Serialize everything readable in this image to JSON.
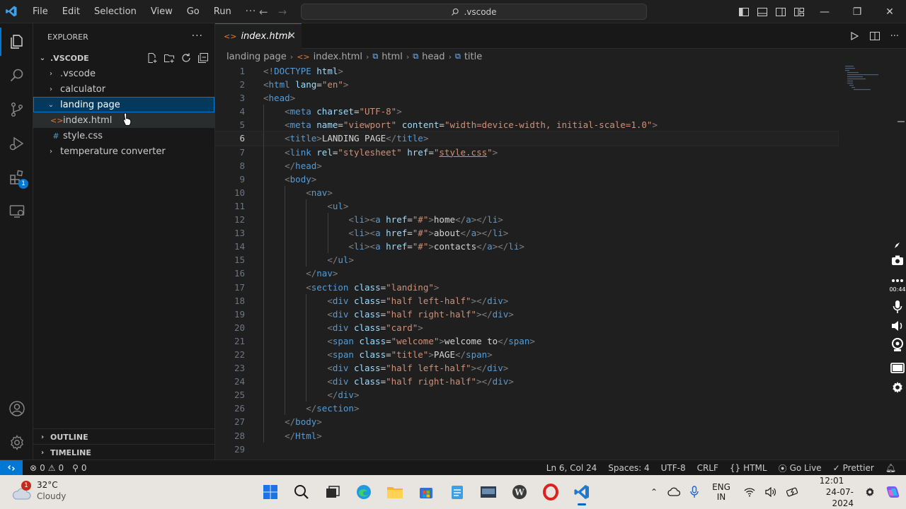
{
  "menu": [
    "File",
    "Edit",
    "Selection",
    "View",
    "Go",
    "Run",
    "···"
  ],
  "search": {
    "text": ".vscode"
  },
  "sidebar": {
    "title": "EXPLORER",
    "more": "···",
    "root": ".VSCODE",
    "items": [
      {
        "label": ".vscode",
        "type": "folder",
        "depth": 0,
        "expanded": false
      },
      {
        "label": "calculator",
        "type": "folder",
        "depth": 0,
        "expanded": false
      },
      {
        "label": "landing page",
        "type": "folder",
        "depth": 0,
        "expanded": true,
        "selected": true
      },
      {
        "label": "index.html",
        "type": "html",
        "depth": 1
      },
      {
        "label": "style.css",
        "type": "css",
        "depth": 1
      },
      {
        "label": "temperature converter",
        "type": "folder",
        "depth": 0,
        "expanded": false
      }
    ],
    "outline": "OUTLINE",
    "timeline": "TIMELINE"
  },
  "activity": {
    "extensions_badge": "1"
  },
  "tab": {
    "label": "index.html",
    "close": "✕"
  },
  "breadcrumb": [
    "landing page",
    "index.html",
    "html",
    "head",
    "title"
  ],
  "editor": {
    "current_line": 6,
    "lines": [
      "<!DOCTYPE html>",
      "<html lang=\"en\">",
      "<head>",
      "    <meta charset=\"UTF-8\">",
      "    <meta name=\"viewport\" content=\"width=device-width, initial-scale=1.0\">",
      "    <title>LANDING PAGE</title>",
      "    <link rel=\"stylesheet\" href=\"style.css\">",
      "    </head>",
      "    <body>",
      "        <nav>",
      "            <ul>",
      "                <li><a href=\"#\">home</a></li>",
      "                <li><a href=\"#\">about</a></li>",
      "                <li><a href=\"#\">contacts</a></li>",
      "            </ul>",
      "        </nav>",
      "        <section class=\"landing\">",
      "            <div class=\"half left-half\"></div>",
      "            <div class=\"half right-half\"></div>",
      "            <div class=\"card\">",
      "            <span class=\"welcome\">welcome to</span>",
      "            <span class=\"title\">PAGE</span>",
      "            <div class=\"half left-half\"></div>",
      "            <div class=\"half right-half\"></div>",
      "            </div>",
      "        </section>",
      "    </body>",
      "    </Html>",
      ""
    ]
  },
  "overlay": {
    "timer": "00:44"
  },
  "statusbar": {
    "errors": "0",
    "warnings": "0",
    "ports": "0",
    "position": "Ln 6, Col 24",
    "spaces": "Spaces: 4",
    "encoding": "UTF-8",
    "eol": "CRLF",
    "language": "HTML",
    "golive": "Go Live",
    "prettier": "Prettier"
  },
  "taskbar": {
    "weather_badge": "1",
    "temp": "32°C",
    "condition": "Cloudy",
    "lang1": "ENG",
    "lang2": "IN",
    "time": "12:01",
    "date": "24-07-2024"
  },
  "colors": {
    "accent": "#0078d4",
    "selection": "#04395e",
    "tag": "#569cd6",
    "attr": "#9cdcfe",
    "string": "#ce9178"
  }
}
